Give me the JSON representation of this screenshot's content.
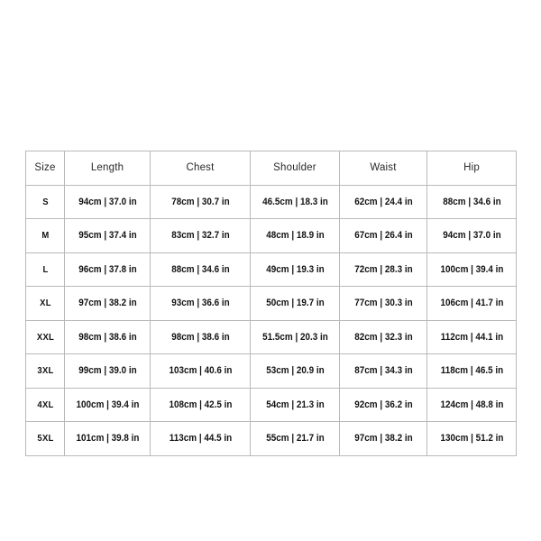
{
  "table": {
    "columns": [
      "Size",
      "Length",
      "Chest",
      "Shoulder",
      "Waist",
      "Hip"
    ],
    "rows": [
      {
        "size": "S",
        "length": "94cm | 37.0 in",
        "chest": "78cm | 30.7 in",
        "shoulder": "46.5cm | 18.3 in",
        "waist": "62cm | 24.4 in",
        "hip": "88cm | 34.6 in"
      },
      {
        "size": "M",
        "length": "95cm | 37.4 in",
        "chest": "83cm | 32.7 in",
        "shoulder": "48cm | 18.9 in",
        "waist": "67cm | 26.4 in",
        "hip": "94cm | 37.0 in"
      },
      {
        "size": "L",
        "length": "96cm | 37.8 in",
        "chest": "88cm | 34.6 in",
        "shoulder": "49cm | 19.3 in",
        "waist": "72cm | 28.3 in",
        "hip": "100cm | 39.4 in"
      },
      {
        "size": "XL",
        "length": "97cm | 38.2 in",
        "chest": "93cm | 36.6 in",
        "shoulder": "50cm | 19.7 in",
        "waist": "77cm | 30.3 in",
        "hip": "106cm | 41.7 in"
      },
      {
        "size": "XXL",
        "length": "98cm | 38.6 in",
        "chest": "98cm | 38.6 in",
        "shoulder": "51.5cm | 20.3 in",
        "waist": "82cm | 32.3 in",
        "hip": "112cm | 44.1 in"
      },
      {
        "size": "3XL",
        "length": "99cm | 39.0 in",
        "chest": "103cm | 40.6 in",
        "shoulder": "53cm | 20.9 in",
        "waist": "87cm | 34.3 in",
        "hip": "118cm | 46.5 in"
      },
      {
        "size": "4XL",
        "length": "100cm | 39.4 in",
        "chest": "108cm | 42.5 in",
        "shoulder": "54cm | 21.3 in",
        "waist": "92cm | 36.2 in",
        "hip": "124cm | 48.8 in"
      },
      {
        "size": "5XL",
        "length": "101cm | 39.8 in",
        "chest": "113cm | 44.5 in",
        "shoulder": "55cm | 21.7 in",
        "waist": "97cm | 38.2 in",
        "hip": "130cm | 51.2 in"
      }
    ]
  },
  "colors": {
    "background": "#ffffff",
    "border": "#b9b9b9",
    "header_divider": "#8f8f8f",
    "header_text": "#2a2a2a",
    "data_text": "#121212"
  }
}
